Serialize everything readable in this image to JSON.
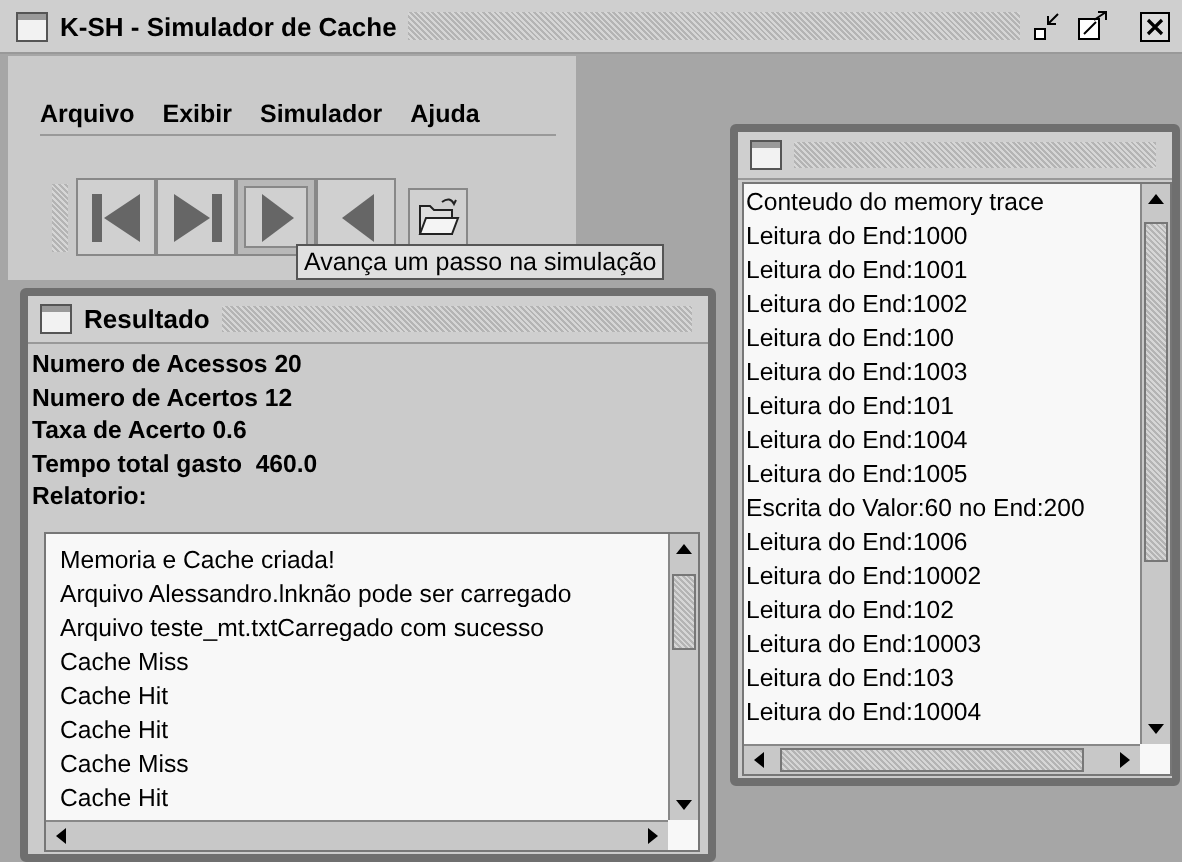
{
  "window": {
    "title": "K-SH - Simulador de Cache"
  },
  "menu": [
    "Arquivo",
    "Exibir",
    "Simulador",
    "Ajuda"
  ],
  "toolbar": [
    {
      "kind": "first",
      "selected": false
    },
    {
      "kind": "last",
      "selected": false
    },
    {
      "kind": "forward",
      "selected": true
    },
    {
      "kind": "back",
      "selected": false
    },
    {
      "kind": "open",
      "selected": false
    }
  ],
  "tooltip": "Avança um passo na simulação",
  "result_frame": {
    "title": "Resultado",
    "stats": [
      "Numero de Acessos 20",
      "Numero de Acertos 12",
      "Taxa de Acerto 0.6",
      "Tempo total gasto  460.0"
    ],
    "report_label": "Relatorio:",
    "report": [
      "Memoria e Cache criada!",
      "Arquivo Alessandro.lnknão pode ser carregado",
      "Arquivo teste_mt.txtCarregado com sucesso",
      "Cache Miss",
      "Cache Hit",
      "Cache Hit",
      "Cache Miss",
      "Cache Hit"
    ]
  },
  "trace_frame": {
    "lines": [
      "Conteudo do memory trace",
      "Leitura do End:1000",
      "Leitura do End:1001",
      "Leitura do End:1002",
      "Leitura do End:100",
      "Leitura do End:1003",
      "Leitura do End:101",
      "Leitura do End:1004",
      "Leitura do End:1005",
      "Escrita do Valor:60 no End:200",
      "Leitura do End:1006",
      "Leitura do End:10002",
      "Leitura do End:102",
      "Leitura do End:10003",
      "Leitura do End:103",
      "Leitura do End:10004"
    ]
  }
}
